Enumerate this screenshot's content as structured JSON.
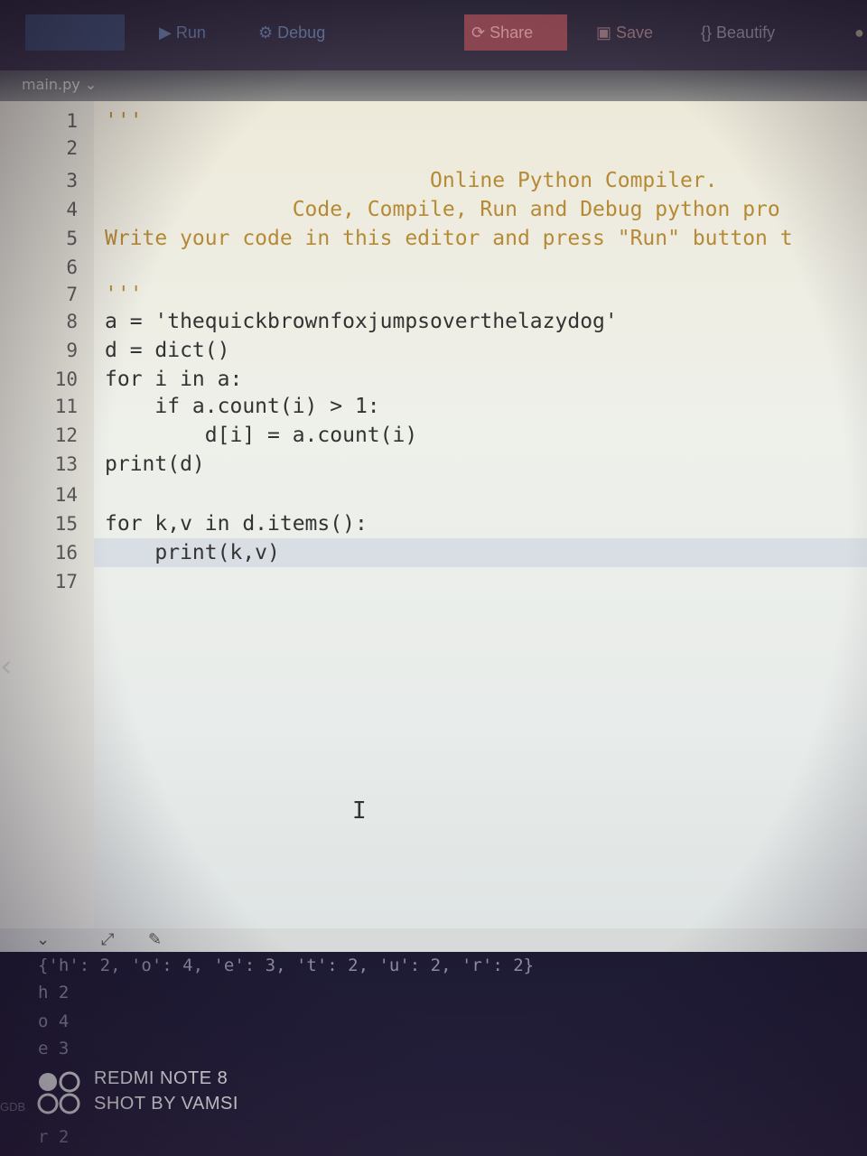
{
  "toolbar": {
    "run_label": "Run",
    "debug_label": "Debug",
    "share_label": "Share",
    "save_label": "Save",
    "beautify_label": "Beautify"
  },
  "file_tab": {
    "name": "main.py"
  },
  "editor": {
    "lines": [
      {
        "no": "1",
        "text": "'''"
      },
      {
        "no": "2",
        "text": ""
      },
      {
        "no": "3",
        "text": "                          Online Python Compiler."
      },
      {
        "no": "4",
        "text": "               Code, Compile, Run and Debug python pro"
      },
      {
        "no": "5",
        "text": "Write your code in this editor and press \"Run\" button t"
      },
      {
        "no": "6",
        "text": ""
      },
      {
        "no": "7",
        "text": "'''"
      },
      {
        "no": "8",
        "text": "a = 'thequickbrownfoxjumpsoverthelazydog'"
      },
      {
        "no": "9",
        "text": "d = dict()"
      },
      {
        "no": "10",
        "text": "for i in a:"
      },
      {
        "no": "11",
        "text": "    if a.count(i) > 1:"
      },
      {
        "no": "12",
        "text": "        d[i] = a.count(i)"
      },
      {
        "no": "13",
        "text": "print(d)"
      },
      {
        "no": "14",
        "text": ""
      },
      {
        "no": "15",
        "text": "for k,v in d.items():"
      },
      {
        "no": "16",
        "text": "    print(k,v)"
      },
      {
        "no": "17",
        "text": ""
      }
    ]
  },
  "console": {
    "lines": [
      "{'h': 2, 'o': 4, 'e': 3, 't': 2, 'u': 2, 'r': 2}",
      "h 2",
      "o 4",
      "e 3",
      "",
      "",
      "r 2"
    ],
    "gdb_label": "GDB"
  },
  "watermark": {
    "line1": "REDMI NOTE 8",
    "line2": "SHOT BY VAMSI"
  }
}
